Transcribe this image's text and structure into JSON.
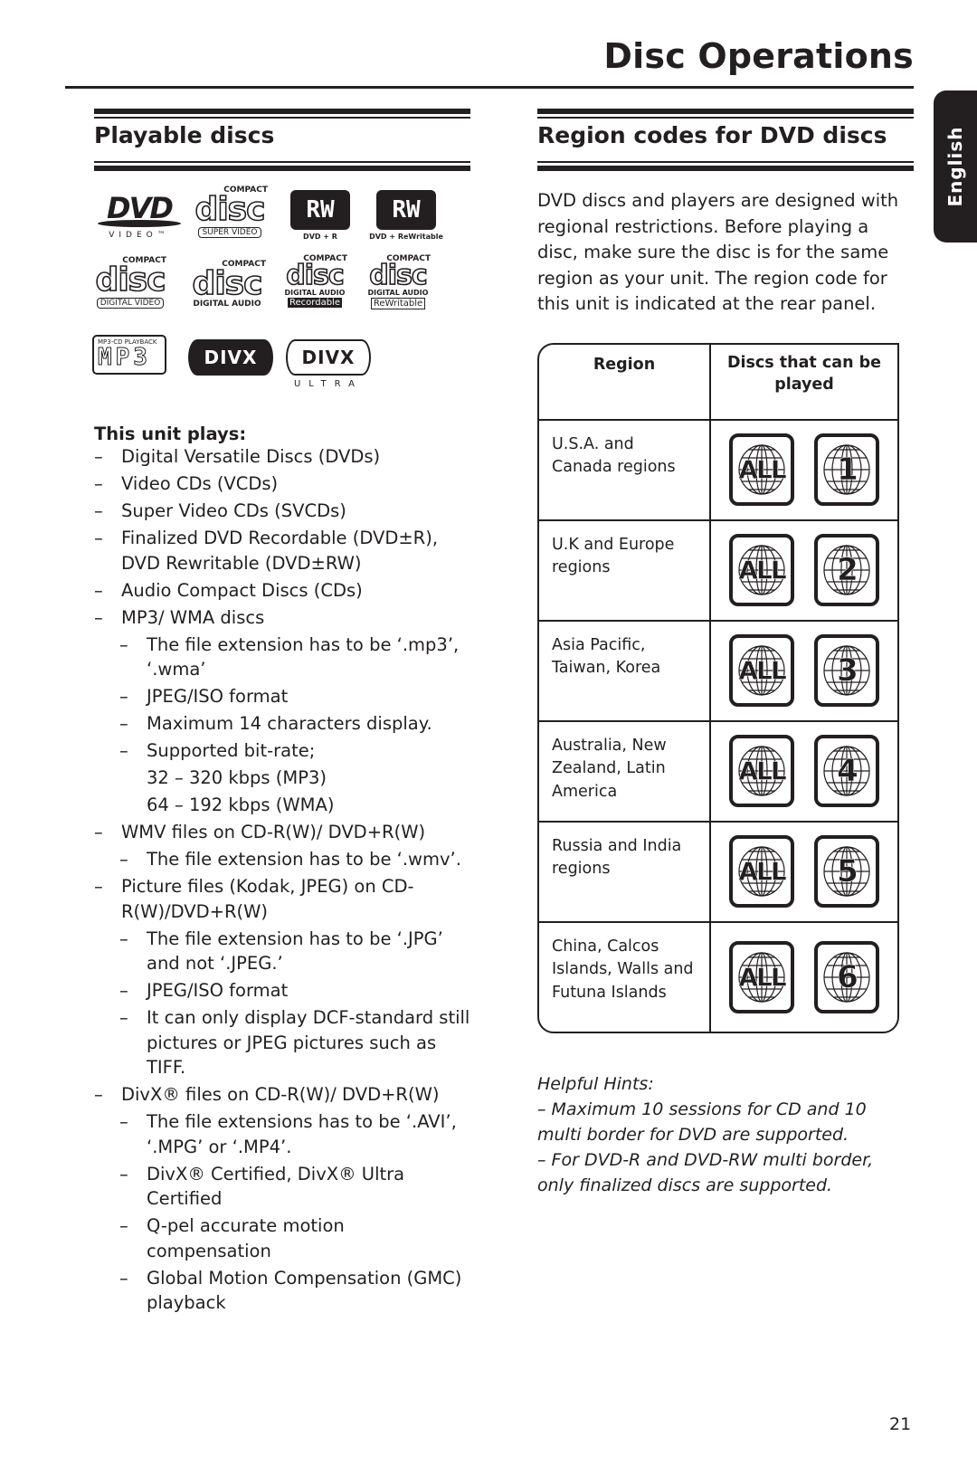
{
  "page": {
    "title": "Disc Operations",
    "language_tab": "English",
    "page_number": "21"
  },
  "left": {
    "heading": "Playable discs",
    "logos": [
      {
        "name": "dvd-video-logo",
        "main": "DVD",
        "sub": "VIDEO™"
      },
      {
        "name": "svcd-logo",
        "top": "COMPACT",
        "main": "disc",
        "sub": "SUPER VIDEO"
      },
      {
        "name": "dvd-plus-r-logo",
        "main": "RW",
        "sub": "DVD + R"
      },
      {
        "name": "dvd-plus-rw-logo",
        "main": "RW",
        "sub": "DVD + ReWritable"
      },
      {
        "name": "vcd-logo",
        "top": "COMPACT",
        "main": "disc",
        "sub": "DIGITAL VIDEO"
      },
      {
        "name": "cd-da-logo",
        "top": "COMPACT",
        "main": "disc",
        "sub": "DIGITAL AUDIO"
      },
      {
        "name": "cd-r-logo",
        "top": "COMPACT",
        "main": "disc",
        "sub": "DIGITAL AUDIO",
        "sub2": "Recordable"
      },
      {
        "name": "cd-rw-logo",
        "top": "COMPACT",
        "main": "disc",
        "sub": "DIGITAL AUDIO",
        "sub2": "ReWritable"
      },
      {
        "name": "mp3-logo",
        "top": "MP3-CD PLAYBACK",
        "main": "MP3"
      },
      {
        "name": "divx-logo",
        "main": "DIVX"
      },
      {
        "name": "divx-ultra-logo",
        "main": "DIVX",
        "sub": "ULTRA"
      }
    ],
    "plays_heading": "This unit plays:",
    "items": [
      {
        "level": 1,
        "text": "Digital Versatile Discs (DVDs)"
      },
      {
        "level": 1,
        "text": "Video CDs (VCDs)"
      },
      {
        "level": 1,
        "text": "Super Video CDs (SVCDs)"
      },
      {
        "level": 1,
        "text": "Finalized DVD Recordable (DVD±R), DVD Rewritable (DVD±RW)"
      },
      {
        "level": 1,
        "text": "Audio Compact Discs (CDs)"
      },
      {
        "level": 1,
        "text": "MP3/ WMA discs"
      },
      {
        "level": 2,
        "text": "The file extension has to be ‘.mp3’, ‘.wma’"
      },
      {
        "level": 2,
        "text": "JPEG/ISO format"
      },
      {
        "level": 2,
        "text": "Maximum 14 characters display."
      },
      {
        "level": 2,
        "text": "Supported bit-rate;"
      },
      {
        "level": 0,
        "text": "32 – 320 kbps (MP3)"
      },
      {
        "level": 0,
        "text": "64 – 192 kbps (WMA)"
      },
      {
        "level": 1,
        "text": "WMV files on CD-R(W)/ DVD+R(W)"
      },
      {
        "level": 2,
        "text": "The file extension has to be ‘.wmv’."
      },
      {
        "level": 1,
        "text": "Picture files (Kodak, JPEG) on CD-R(W)/DVD+R(W)"
      },
      {
        "level": 2,
        "text": "The file extension has to be ‘.JPG’ and not ‘.JPEG.’"
      },
      {
        "level": 2,
        "text": "JPEG/ISO format"
      },
      {
        "level": 2,
        "text": "It can only display DCF-standard still pictures or JPEG pictures such as TIFF."
      },
      {
        "level": 1,
        "text": "DivX® files on CD-R(W)/ DVD+R(W)"
      },
      {
        "level": 2,
        "text": "The file extensions has to be ‘.AVI’, ‘.MPG’ or ‘.MP4’."
      },
      {
        "level": 2,
        "text": "DivX® Certified, DivX® Ultra Certified"
      },
      {
        "level": 2,
        "text": "Q-pel accurate motion compensation"
      },
      {
        "level": 2,
        "text": "Global Motion Compensation (GMC) playback"
      }
    ]
  },
  "right": {
    "heading": "Region codes for DVD discs",
    "intro": "DVD discs and players are designed with regional restrictions. Before playing a disc, make sure the disc is for the same region as your unit. The region code for this unit is indicated at the rear panel.",
    "table": {
      "headers": [
        "Region",
        "Discs that can be played"
      ],
      "rows": [
        {
          "region": "U.S.A. and Canada regions",
          "codes": [
            "ALL",
            "1"
          ]
        },
        {
          "region": "U.K and Europe regions",
          "codes": [
            "ALL",
            "2"
          ]
        },
        {
          "region": "Asia Pacific, Taiwan, Korea",
          "codes": [
            "ALL",
            "3"
          ]
        },
        {
          "region": "Australia, New Zealand, Latin America",
          "codes": [
            "ALL",
            "4"
          ]
        },
        {
          "region": "Russia and India regions",
          "codes": [
            "ALL",
            "5"
          ]
        },
        {
          "region": "China, Calcos Islands, Walls and Futuna Islands",
          "codes": [
            "ALL",
            "6"
          ]
        }
      ]
    },
    "hints": {
      "title": "Helpful Hints:",
      "items": [
        "–  Maximum 10 sessions for CD and 10 multi border for DVD are supported.",
        "–  For DVD-R and DVD-RW multi border, only finalized discs are supported."
      ]
    }
  }
}
